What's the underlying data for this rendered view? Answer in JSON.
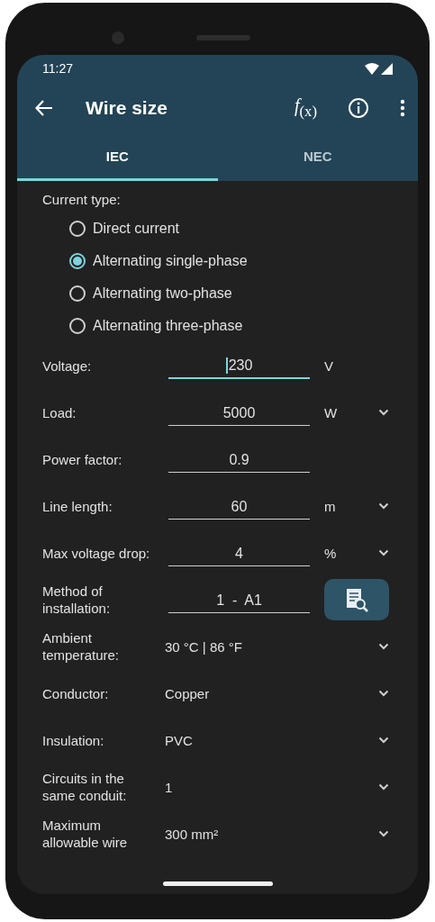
{
  "status_bar": {
    "time": "11:27"
  },
  "toolbar": {
    "title": "Wire size",
    "formula": "*f*$_{(x)}$"
  },
  "tabs": [
    {
      "label": "IEC",
      "selected": true
    },
    {
      "label": "NEC",
      "selected": false
    }
  ],
  "current_type": {
    "label": "Current type:",
    "options": [
      {
        "label": "Direct current",
        "selected": false
      },
      {
        "label": "Alternating single-phase",
        "selected": true
      },
      {
        "label": "Alternating two-phase",
        "selected": false
      },
      {
        "label": "Alternating three-phase",
        "selected": false
      }
    ]
  },
  "rows": [
    {
      "kind": "input",
      "label": "Voltage:",
      "value": "230",
      "unit": "V",
      "focused": true,
      "dropdown": false
    },
    {
      "kind": "input",
      "label": "Load:",
      "value": "5000",
      "unit": "W",
      "focused": false,
      "dropdown": true
    },
    {
      "kind": "input",
      "label": "Power factor:",
      "value": "0.9",
      "focused": false,
      "dropdown": false
    },
    {
      "kind": "input",
      "label": "Line length:",
      "value": "60",
      "unit": "m",
      "focused": false,
      "dropdown": true
    },
    {
      "kind": "input",
      "label": "Max voltage drop:",
      "value": "4",
      "unit": "%",
      "focused": false,
      "dropdown": true
    },
    {
      "kind": "lookup",
      "label": "Method of installation:",
      "value": "1  -  A1"
    },
    {
      "kind": "select",
      "label": "Ambient temperature:",
      "value": "30 °C | 86 °F"
    },
    {
      "kind": "select",
      "label": "Conductor:",
      "value": "Copper"
    },
    {
      "kind": "select",
      "label": "Insulation:",
      "value": "PVC"
    },
    {
      "kind": "select",
      "label": "Circuits in the same conduit:",
      "value": "1"
    },
    {
      "kind": "select",
      "label": "Maximum allowable wire",
      "value": "300 mm²"
    }
  ]
}
